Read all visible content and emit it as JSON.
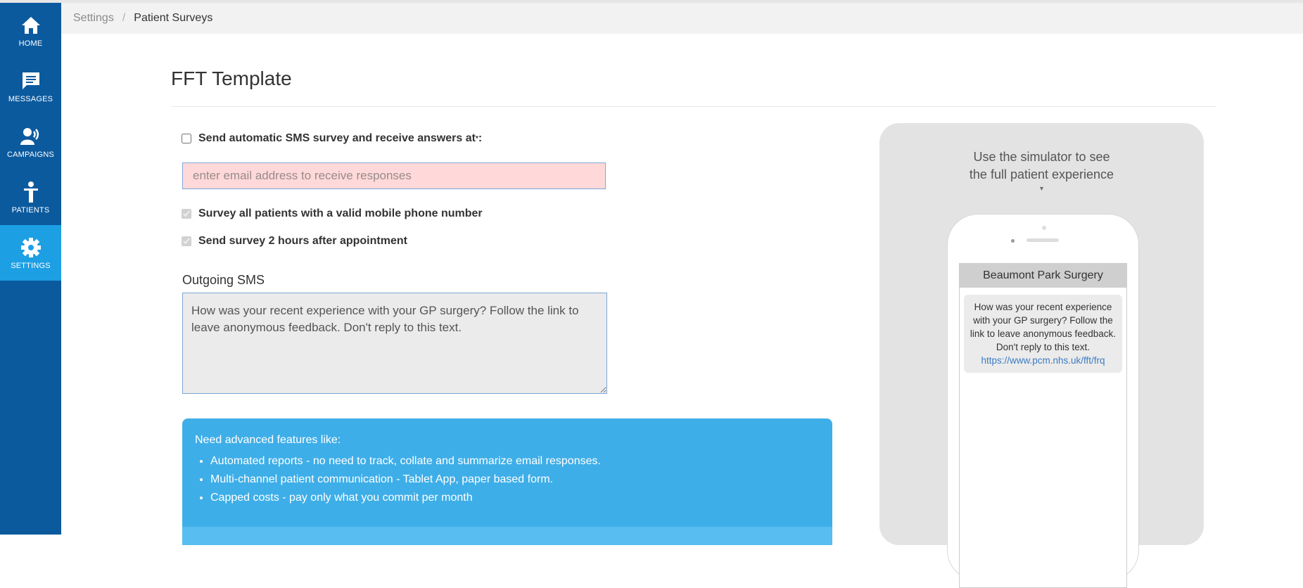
{
  "sidebar": {
    "items": [
      {
        "label": "HOME",
        "icon": "home-icon"
      },
      {
        "label": "MESSAGES",
        "icon": "message-icon"
      },
      {
        "label": "CAMPAIGNS",
        "icon": "megaphone-icon"
      },
      {
        "label": "PATIENTS",
        "icon": "person-icon"
      },
      {
        "label": "SETTINGS",
        "icon": "gear-icon",
        "active": true
      }
    ],
    "bg_color": "#0c5a9e",
    "active_color": "#1d9fe4"
  },
  "breadcrumb": {
    "items": [
      "Settings",
      "Patient Surveys"
    ],
    "separator": "/"
  },
  "page": {
    "title": "FFT Template"
  },
  "form": {
    "auto_sms_label": "Send automatic SMS survey and receive answers at ",
    "required_mark": "*",
    "colon": ":",
    "auto_sms_checked": false,
    "email_value": "",
    "email_placeholder": "enter email address to receive responses",
    "survey_all_label": "Survey all patients with a valid mobile phone number",
    "survey_all_checked": true,
    "send_after_label": "Send survey 2 hours after appointment",
    "send_after_checked": true,
    "sms_label": "Outgoing SMS",
    "sms_text": "How was your recent experience with your GP surgery? Follow the link to leave anonymous feedback. Don't reply to this text."
  },
  "promo": {
    "heading": "Need advanced features like:",
    "items": [
      "Automated reports - no need to track, collate and summarize email responses.",
      "Multi-channel patient communication - Tablet App, paper based form.",
      "Capped costs - pay only what you commit per month"
    ],
    "bg_color": "#3eaee8"
  },
  "simulator": {
    "hint_line1": "Use the simulator to see",
    "hint_line2": "the full patient experience",
    "caret": "▾",
    "practice_name": "Beaumont Park Surgery",
    "message": "How was your recent experience with your GP surgery? Follow the link to leave anonymous feedback. Don't reply to this text.",
    "link": "https://www.pcm.nhs.uk/fft/frq"
  }
}
